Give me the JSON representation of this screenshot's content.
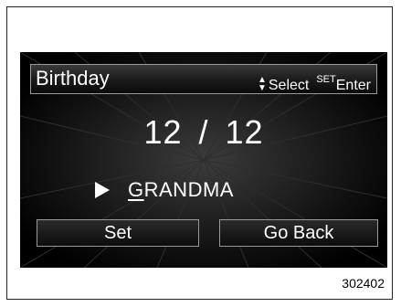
{
  "header": {
    "title": "Birthday",
    "select_hint": "Select",
    "set_sup": "SET",
    "enter_hint": "Enter"
  },
  "date": {
    "month": "12",
    "separator": "/",
    "day": "12"
  },
  "entry": {
    "name_first": "G",
    "name_rest": "RANDMA"
  },
  "buttons": {
    "set_label": "Set",
    "back_label": "Go Back"
  },
  "figure_number": "302402"
}
